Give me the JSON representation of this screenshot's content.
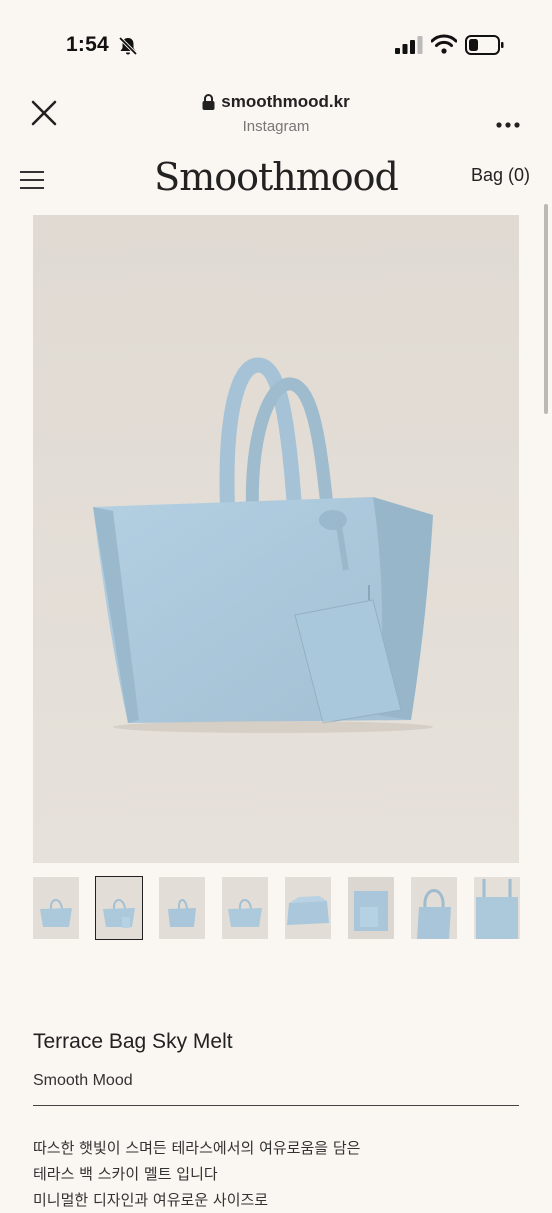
{
  "status_bar": {
    "time": "1:54",
    "icons": [
      "bell-slash-icon",
      "cellular-signal-icon",
      "wifi-icon",
      "battery-icon"
    ]
  },
  "browser": {
    "url": "smoothmood.kr",
    "subtitle": "Instagram",
    "icons": [
      "close-icon",
      "lock-icon",
      "more-icon"
    ]
  },
  "site": {
    "logo": "Smoothmood",
    "bag_label": "Bag (0)",
    "menu_icon": "hamburger-menu-icon"
  },
  "product": {
    "title": "Terrace Bag Sky Melt",
    "brand": "Smooth Mood",
    "description_lines": [
      "따스한 햇빛이 스며든 테라스에서의 여유로움을 담은",
      "테라스 백 스카이 멜트 입니다",
      "미니멀한 디자인과 여유로운 사이즈로"
    ],
    "thumbnail_count": 8,
    "active_thumbnail": 2
  },
  "colors": {
    "page_background": "#faf6f1",
    "photo_background": "#e4dfd8",
    "bag_color": "#a9c7dc"
  }
}
